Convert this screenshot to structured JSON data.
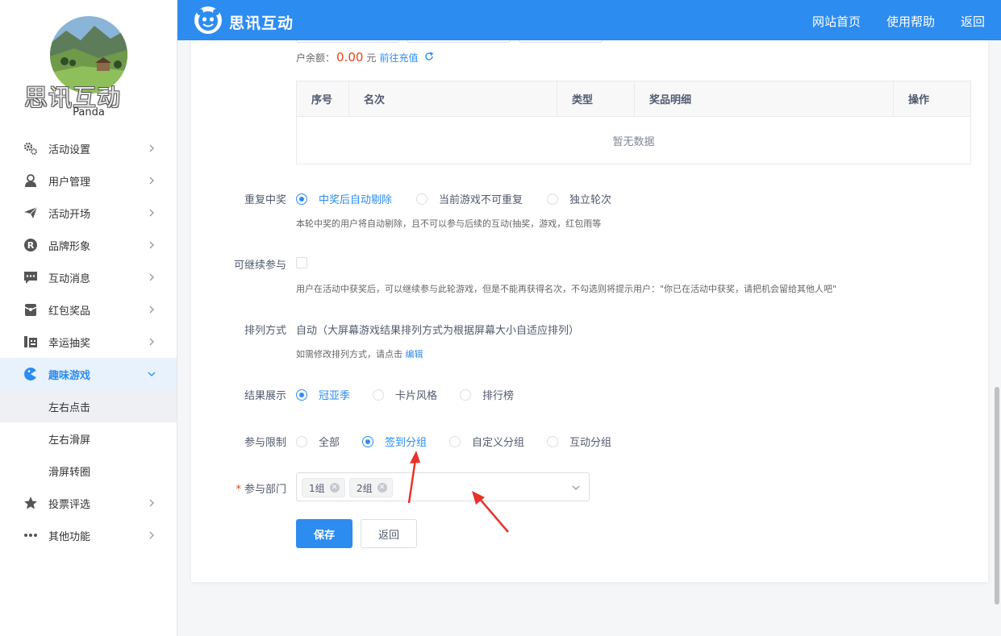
{
  "header": {
    "app_title": "思讯互动",
    "nav": [
      "网站首页",
      "使用帮助",
      "返回"
    ],
    "color": "#2d8cf0"
  },
  "sidebar": {
    "brand_watermark": "思讯互动",
    "username": "Panda",
    "items": [
      {
        "label": "活动设置",
        "icon": "gears-icon"
      },
      {
        "label": "用户管理",
        "icon": "user-icon"
      },
      {
        "label": "活动开场",
        "icon": "paper-plane-icon"
      },
      {
        "label": "品牌形象",
        "icon": "registered-icon"
      },
      {
        "label": "互动消息",
        "icon": "chat-icon"
      },
      {
        "label": "红包奖品",
        "icon": "red-packet-icon"
      },
      {
        "label": "幸运抽奖",
        "icon": "lottery-icon"
      },
      {
        "label": "趣味游戏",
        "icon": "game-icon",
        "active": true
      },
      {
        "label": "投票评选",
        "icon": "star-icon"
      },
      {
        "label": "其他功能",
        "icon": "more-icon"
      }
    ],
    "subitems": [
      {
        "label": "左右点击",
        "active": true
      },
      {
        "label": "左右滑屏"
      },
      {
        "label": "滑屏转圈"
      }
    ]
  },
  "balance": {
    "prefix": "户余额：",
    "amount": "0.00",
    "unit": "元",
    "recharge": "前往充值",
    "refresh_icon": "refresh-icon"
  },
  "prize_table": {
    "columns": [
      "序号",
      "名次",
      "类型",
      "奖品明细",
      "操作"
    ],
    "empty_text": "暂无数据"
  },
  "form": {
    "repeat": {
      "label": "重复中奖",
      "options": [
        "中奖后自动剔除",
        "当前游戏不可重复",
        "独立轮次"
      ],
      "selected": 0,
      "hint": "本轮中奖的用户将自动剔除，且不可以参与后续的互动(抽奖，游戏，红包雨等"
    },
    "continue": {
      "label": "可继续参与",
      "checked": false,
      "hint": "用户在活动中获奖后，可以继续参与此轮游戏，但是不能再获得名次，不勾选则将提示用户：\"你已在活动中获奖，请把机会留给其他人吧\""
    },
    "sort": {
      "label": "排列方式",
      "value": "自动（大屏幕游戏结果排列方式为根据屏幕大小自适应排列）",
      "hint_prefix": "如需修改排列方式，请点击",
      "hint_link": "编辑"
    },
    "result": {
      "label": "结果展示",
      "options": [
        "冠亚季",
        "卡片风格",
        "排行榜"
      ],
      "selected": 0
    },
    "limit": {
      "label": "参与限制",
      "options": [
        "全部",
        "签到分组",
        "自定义分组",
        "互动分组"
      ],
      "selected": 1
    },
    "department": {
      "label": "参与部门",
      "required_mark": "*",
      "tags": [
        "1组",
        "2组"
      ]
    },
    "save_label": "保存",
    "back_label": "返回"
  }
}
